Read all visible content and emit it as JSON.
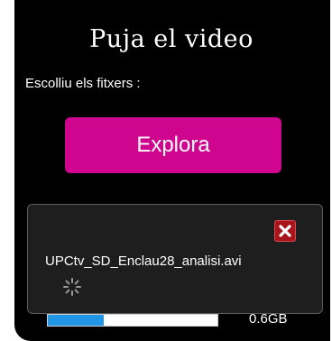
{
  "upload": {
    "title": "Puja el video",
    "choose_label": "Escolliu els fitxers :",
    "browse_label": "Explora"
  },
  "file": {
    "name": "UPCtv_SD_Enclau28_analisi.avi",
    "size": "0.6GB",
    "remove_icon": "close-icon",
    "status_icon": "loading-spinner-icon",
    "progress": 0.33
  },
  "colors": {
    "accent": "#d0058f",
    "progress": "#2196e6",
    "remove": "#a8141b"
  }
}
